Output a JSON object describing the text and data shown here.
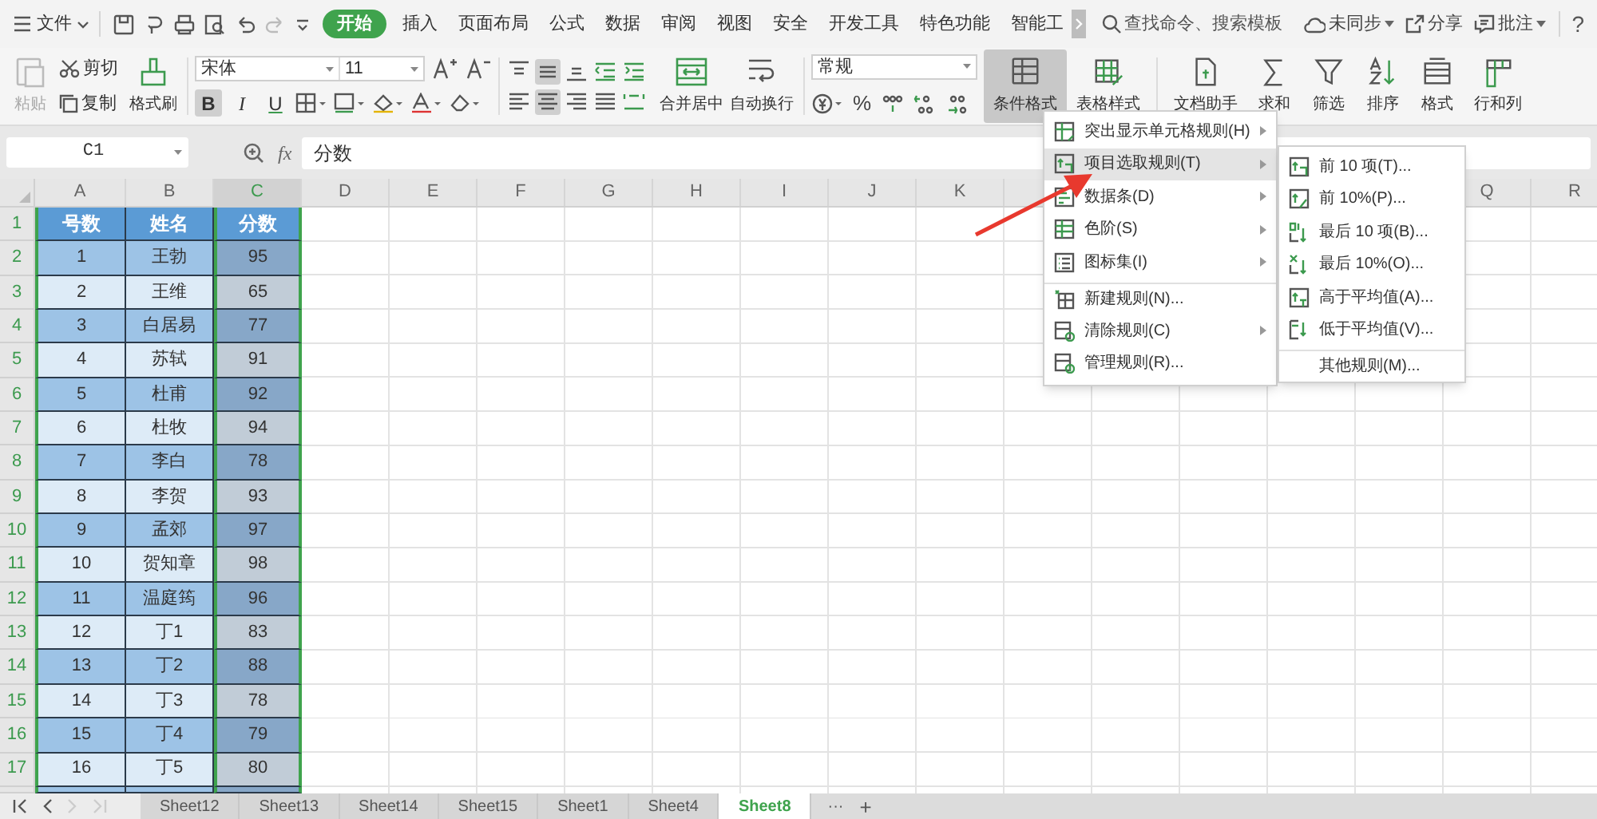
{
  "menu_bar": {
    "file": "文件",
    "tabs": [
      {
        "label": "开始",
        "selected": true
      },
      {
        "label": "插入",
        "selected": false
      },
      {
        "label": "页面布局",
        "selected": false
      },
      {
        "label": "公式",
        "selected": false
      },
      {
        "label": "数据",
        "selected": false
      },
      {
        "label": "审阅",
        "selected": false
      },
      {
        "label": "视图",
        "selected": false
      },
      {
        "label": "安全",
        "selected": false
      },
      {
        "label": "开发工具",
        "selected": false
      },
      {
        "label": "特色功能",
        "selected": false
      },
      {
        "label": "智能工",
        "selected": false
      }
    ],
    "search": "查找命令、搜索模板",
    "sync": "未同步",
    "share": "分享",
    "comment": "批注",
    "help": "?"
  },
  "ribbon": {
    "paste": "粘贴",
    "cut": "剪切",
    "copy": "复制",
    "format_painter": "格式刷",
    "font": "宋体",
    "font_size": "11",
    "style_buttons": [
      {
        "text": "B",
        "on": true
      },
      {
        "text": "I",
        "on": false
      },
      {
        "text": "U",
        "on": false
      }
    ],
    "align_buttons": [
      {
        "kind": "top",
        "on": false
      },
      {
        "kind": "middle",
        "on": true
      },
      {
        "kind": "bottom",
        "on": false
      },
      {
        "kind": "outdent",
        "on": false
      },
      {
        "kind": "indent",
        "on": false
      },
      {
        "kind": "left",
        "on": false
      },
      {
        "kind": "center",
        "on": true
      },
      {
        "kind": "right",
        "on": false
      },
      {
        "kind": "justify",
        "on": false
      },
      {
        "kind": "distributed",
        "on": false
      }
    ],
    "merge": "合并居中",
    "wrap": "自动换行",
    "number_format": "常规",
    "percent": "%",
    "big_buttons": [
      {
        "kind": "conditional",
        "label": "条件格式",
        "on": true
      },
      {
        "kind": "table",
        "label": "表格样式",
        "on": false
      },
      {
        "kind": "doc",
        "label": "文档助手",
        "on": false
      },
      {
        "kind": "sum",
        "label": "求和",
        "on": false
      },
      {
        "kind": "filter",
        "label": "筛选",
        "on": false
      },
      {
        "kind": "sort",
        "label": "排序",
        "on": false
      },
      {
        "kind": "format",
        "label": "格式",
        "on": false
      },
      {
        "kind": "rowcol",
        "label": "行和列",
        "on": false
      }
    ]
  },
  "formula_bar": {
    "cell": "C1",
    "fx": "fx",
    "value": "分数"
  },
  "sheet": {
    "columns": [
      {
        "label": "A",
        "selected": false
      },
      {
        "label": "B",
        "selected": false
      },
      {
        "label": "C",
        "selected": true
      },
      {
        "label": "D",
        "selected": false
      },
      {
        "label": "E",
        "selected": false
      },
      {
        "label": "F",
        "selected": false
      },
      {
        "label": "G",
        "selected": false
      },
      {
        "label": "H",
        "selected": false
      },
      {
        "label": "I",
        "selected": false
      },
      {
        "label": "J",
        "selected": false
      },
      {
        "label": "K",
        "selected": false
      }
    ],
    "columns_after_menu": [
      {
        "label": "Q",
        "selected": false
      },
      {
        "label": "R",
        "selected": false
      }
    ],
    "rows": [
      {
        "number": "1",
        "cells": [
          "号数",
          "姓名",
          "分数"
        ]
      },
      {
        "number": "2",
        "cells": [
          "1",
          "王勃",
          "95"
        ]
      },
      {
        "number": "3",
        "cells": [
          "2",
          "王维",
          "65"
        ]
      },
      {
        "number": "4",
        "cells": [
          "3",
          "白居易",
          "77"
        ]
      },
      {
        "number": "5",
        "cells": [
          "4",
          "苏轼",
          "91"
        ]
      },
      {
        "number": "6",
        "cells": [
          "5",
          "杜甫",
          "92"
        ]
      },
      {
        "number": "7",
        "cells": [
          "6",
          "杜牧",
          "94"
        ]
      },
      {
        "number": "8",
        "cells": [
          "7",
          "李白",
          "78"
        ]
      },
      {
        "number": "9",
        "cells": [
          "8",
          "李贺",
          "93"
        ]
      },
      {
        "number": "10",
        "cells": [
          "9",
          "孟郊",
          "97"
        ]
      },
      {
        "number": "11",
        "cells": [
          "10",
          "贺知章",
          "98"
        ]
      },
      {
        "number": "12",
        "cells": [
          "11",
          "温庭筠",
          "96"
        ]
      },
      {
        "number": "13",
        "cells": [
          "12",
          "丁1",
          "83"
        ]
      },
      {
        "number": "14",
        "cells": [
          "13",
          "丁2",
          "88"
        ]
      },
      {
        "number": "15",
        "cells": [
          "14",
          "丁3",
          "78"
        ]
      },
      {
        "number": "16",
        "cells": [
          "15",
          "丁4",
          "79"
        ]
      },
      {
        "number": "17",
        "cells": [
          "16",
          "丁5",
          "80"
        ]
      }
    ]
  },
  "dropdown_menu": {
    "items": [
      {
        "kind": "highlight",
        "label": "突出显示单元格规则(H)",
        "submenu": true,
        "highlighted": false,
        "divider_before": false
      },
      {
        "kind": "top",
        "label": "项目选取规则(T)",
        "submenu": true,
        "highlighted": true,
        "divider_before": false
      },
      {
        "kind": "databar",
        "label": "数据条(D)",
        "submenu": true,
        "highlighted": false,
        "divider_before": false
      },
      {
        "kind": "scale",
        "label": "色阶(S)",
        "submenu": true,
        "highlighted": false,
        "divider_before": false
      },
      {
        "kind": "iconset",
        "label": "图标集(I)",
        "submenu": true,
        "highlighted": false,
        "divider_before": false
      },
      {
        "kind": "new",
        "label": "新建规则(N)...",
        "submenu": false,
        "highlighted": false,
        "divider_before": true
      },
      {
        "kind": "clear",
        "label": "清除规则(C)",
        "submenu": true,
        "highlighted": false,
        "divider_before": false
      },
      {
        "kind": "manage",
        "label": "管理规则(R)...",
        "submenu": false,
        "highlighted": false,
        "divider_before": false
      }
    ]
  },
  "submenu": {
    "items": [
      {
        "kind": "top10",
        "label": "前 10 项(T)...",
        "divider_before": false
      },
      {
        "kind": "top10p",
        "label": "前 10%(P)...",
        "divider_before": false
      },
      {
        "kind": "bottom10",
        "label": "最后 10 项(B)...",
        "divider_before": false
      },
      {
        "kind": "bottom10p",
        "label": "最后 10%(O)...",
        "divider_before": false
      },
      {
        "kind": "above",
        "label": "高于平均值(A)...",
        "divider_before": false
      },
      {
        "kind": "below",
        "label": "低于平均值(V)...",
        "divider_before": false
      },
      {
        "kind": "none",
        "label": "其他规则(M)...",
        "divider_before": true
      }
    ]
  },
  "sheet_tabs": [
    {
      "label": "Sheet12",
      "selected": false
    },
    {
      "label": "Sheet13",
      "selected": false
    },
    {
      "label": "Sheet14",
      "selected": false
    },
    {
      "label": "Sheet15",
      "selected": false
    },
    {
      "label": "Sheet1",
      "selected": false
    },
    {
      "label": "Sheet4",
      "selected": false
    },
    {
      "label": "Sheet8",
      "selected": true
    }
  ],
  "tab_more": "···",
  "tab_add": "+"
}
